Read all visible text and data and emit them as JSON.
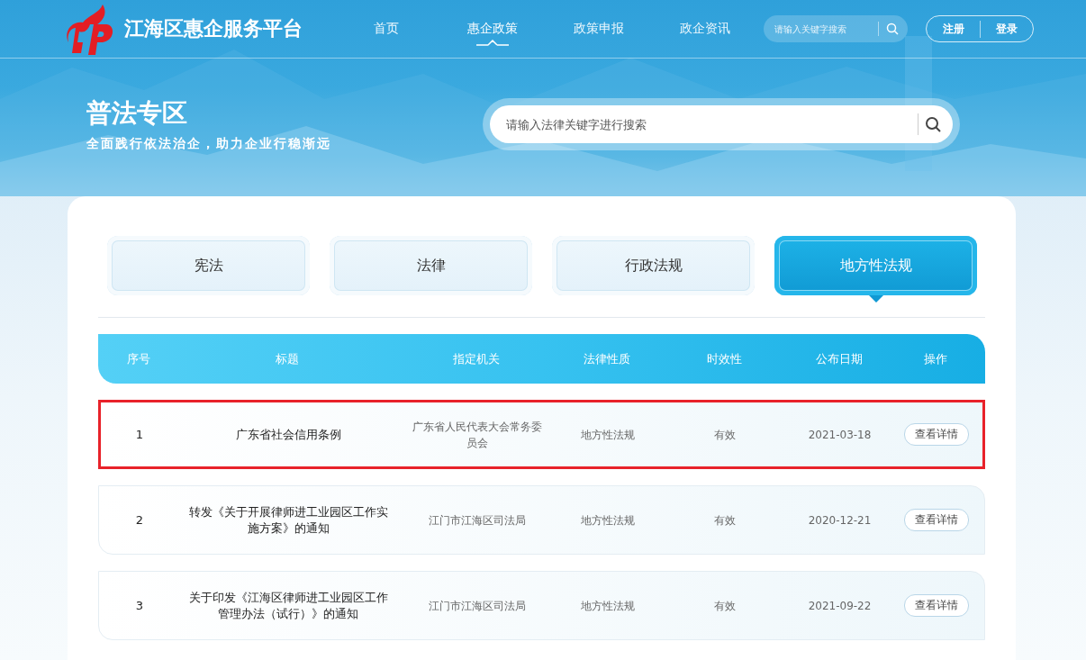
{
  "site": {
    "title": "江海区惠企服务平台"
  },
  "nav": [
    {
      "label": "首页",
      "selected": false
    },
    {
      "label": "惠企政策",
      "selected": true
    },
    {
      "label": "政策申报",
      "selected": false
    },
    {
      "label": "政企资讯",
      "selected": false
    }
  ],
  "header_search": {
    "placeholder": "请输入关键字搜索"
  },
  "account": [
    "注册",
    "登录"
  ],
  "hero": {
    "title": "普法专区",
    "subtitle": "全面践行依法治企，助力企业行稳渐远",
    "search": {
      "placeholder": "请输入法律关键字进行搜索"
    }
  },
  "tabs": [
    {
      "label": "宪法",
      "selected": false
    },
    {
      "label": "法律",
      "selected": false
    },
    {
      "label": "行政法规",
      "selected": false
    },
    {
      "label": "地方性法规",
      "selected": true
    }
  ],
  "table": {
    "columns": [
      "序号",
      "标题",
      "指定机关",
      "法律性质",
      "时效性",
      "公布日期",
      "操作"
    ],
    "rows": [
      {
        "no": "1",
        "title": "广东省社会信用条例",
        "authority": "广东省人民代表大会常务委员会",
        "nature": "地方性法规",
        "validity": "有效",
        "date": "2021-03-18",
        "action": "查看详情",
        "highlighted": true
      },
      {
        "no": "2",
        "title": "转发《关于开展律师进工业园区工作实施方案》的通知",
        "authority": "江门市江海区司法局",
        "nature": "地方性法规",
        "validity": "有效",
        "date": "2020-12-21",
        "action": "查看详情",
        "highlighted": false
      },
      {
        "no": "3",
        "title": "关于印发《江海区律师进工业园区工作管理办法（试行）》的通知",
        "authority": "江门市江海区司法局",
        "nature": "地方性法规",
        "validity": "有效",
        "date": "2021-09-22",
        "action": "查看详情",
        "highlighted": false
      }
    ]
  }
}
